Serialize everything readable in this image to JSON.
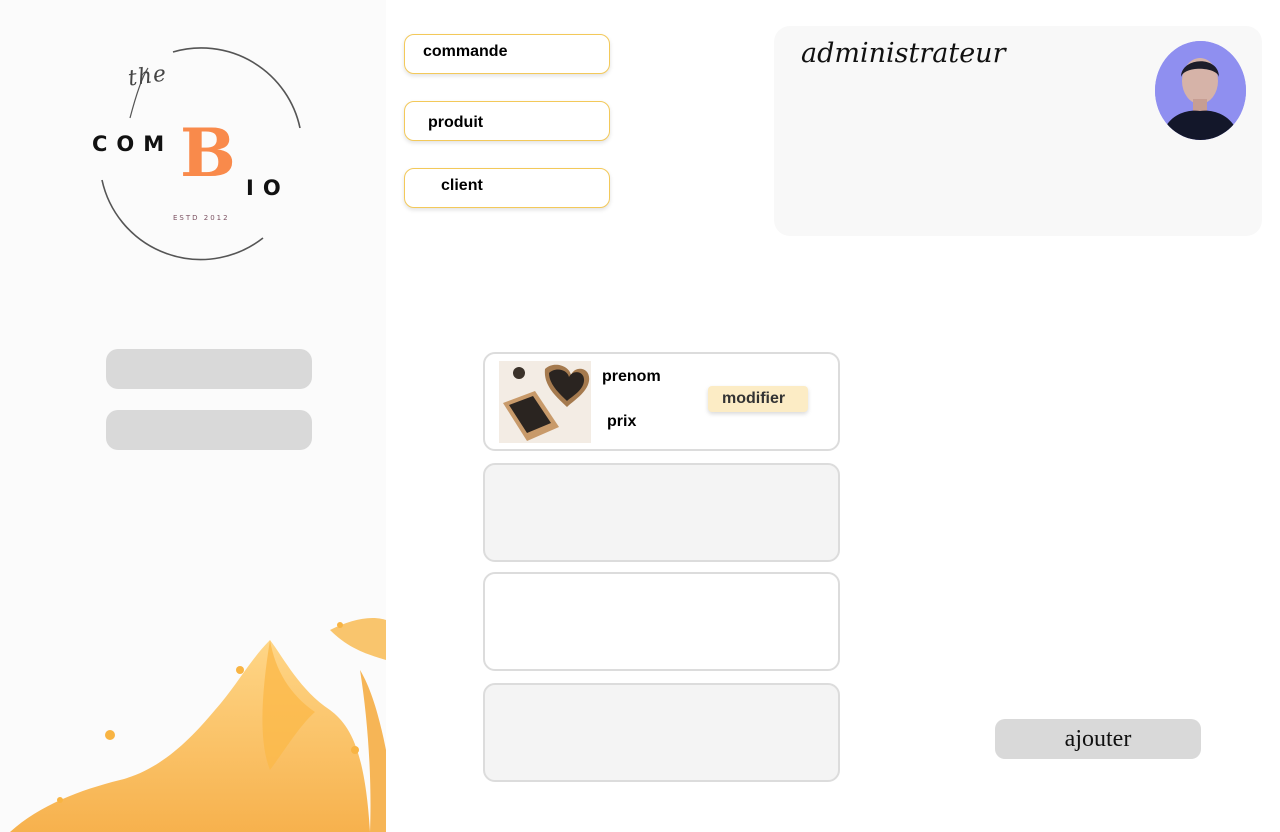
{
  "brand": {
    "logo_the": "the",
    "logo_com": "COM",
    "logo_b": "B",
    "logo_io": "IO",
    "logo_estd": "ESTD 2012",
    "accent_color": "#f98a4b"
  },
  "nav": {
    "items": [
      {
        "label": "commande"
      },
      {
        "label": "produit"
      },
      {
        "label": "client"
      }
    ],
    "border_color": "#f3c95a"
  },
  "admin": {
    "title": "administrateur"
  },
  "products": [
    {
      "name_label": "prenom",
      "price_label": "prix",
      "action_label": "modifier"
    }
  ],
  "actions": {
    "add_label": "ajouter"
  }
}
